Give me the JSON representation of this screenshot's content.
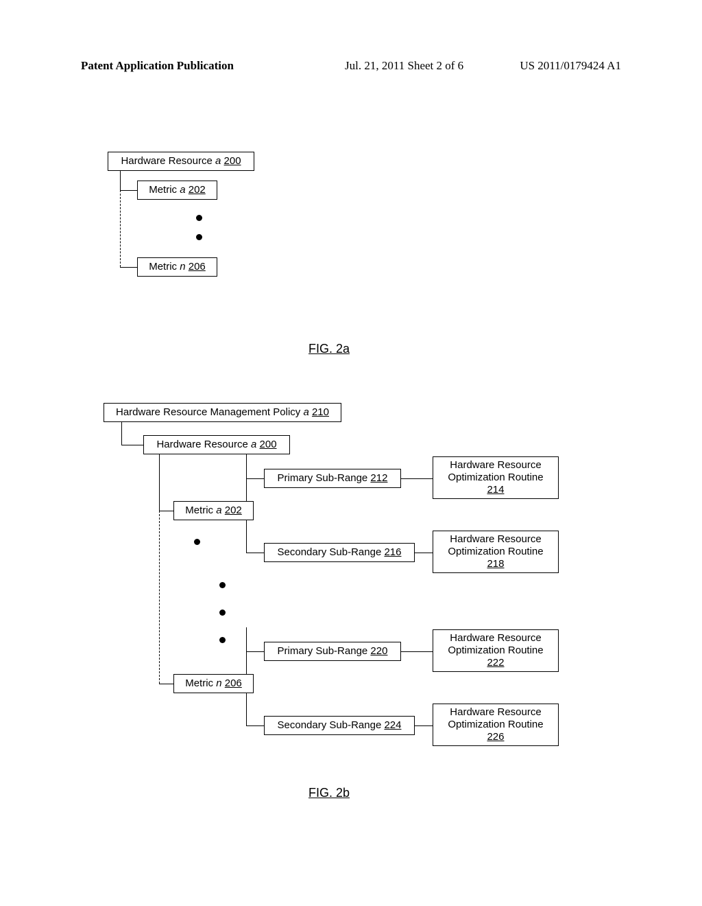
{
  "header": {
    "left": "Patent Application Publication",
    "center": "Jul. 21, 2011  Sheet 2 of 6",
    "right": "US 2011/0179424 A1"
  },
  "fig2a": {
    "caption": "FIG. 2a",
    "hw_resource_a": "Hardware Resource",
    "hw_resource_a_var": "a",
    "hw_resource_a_ref": "200",
    "metric_a": "Metric",
    "metric_a_var": "a",
    "metric_a_ref": "202",
    "metric_n": "Metric",
    "metric_n_var": "n",
    "metric_n_ref": "206"
  },
  "fig2b": {
    "caption": "FIG. 2b",
    "policy": "Hardware Resource Management Policy",
    "policy_var": "a",
    "policy_ref": "210",
    "hw_resource_a": "Hardware Resource",
    "hw_resource_a_var": "a",
    "hw_resource_a_ref": "200",
    "metric_a": "Metric",
    "metric_a_var": "a",
    "metric_a_ref": "202",
    "metric_n": "Metric",
    "metric_n_var": "n",
    "metric_n_ref": "206",
    "primary_a": "Primary Sub-Range",
    "primary_a_ref": "212",
    "secondary_a": "Secondary Sub-Range",
    "secondary_a_ref": "216",
    "primary_n": "Primary Sub-Range",
    "primary_n_ref": "220",
    "secondary_n": "Secondary Sub-Range",
    "secondary_n_ref": "224",
    "opt_line1": "Hardware Resource",
    "opt_line2": "Optimization Routine",
    "opt_a1_ref": "214",
    "opt_a2_ref": "218",
    "opt_n1_ref": "222",
    "opt_n2_ref": "226"
  }
}
